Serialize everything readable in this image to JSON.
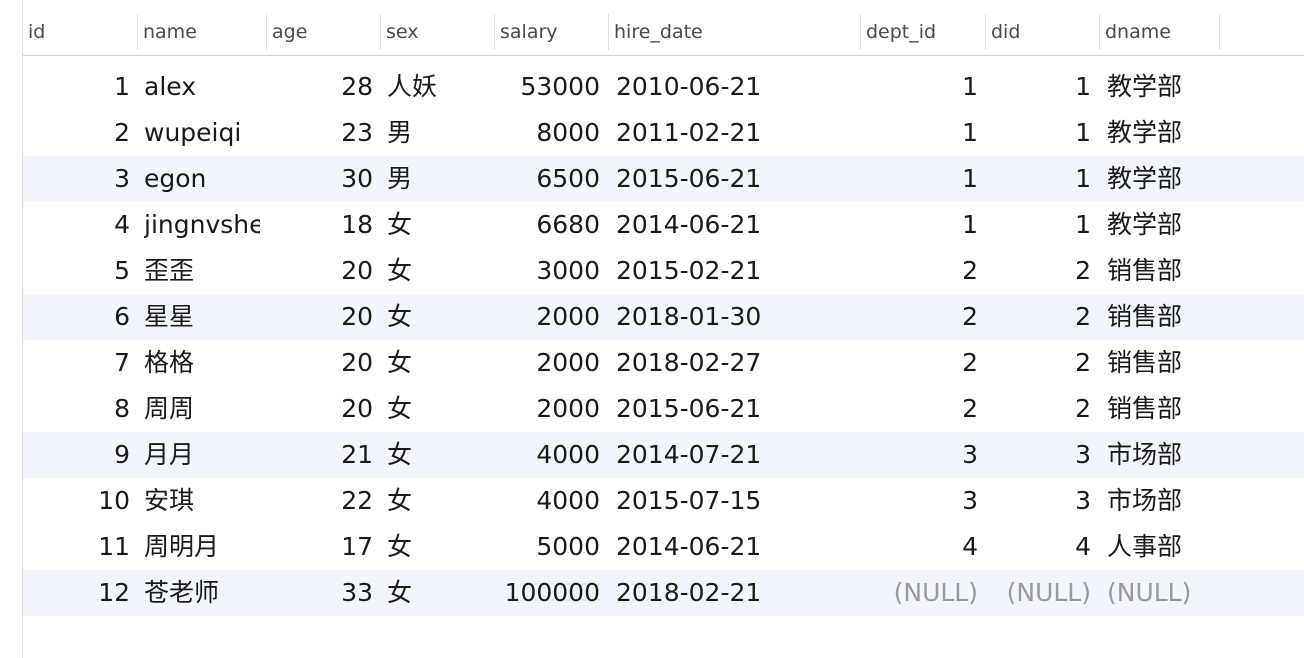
{
  "columns": [
    {
      "key": "id",
      "label": "id"
    },
    {
      "key": "name",
      "label": "name"
    },
    {
      "key": "age",
      "label": "age"
    },
    {
      "key": "sex",
      "label": "sex"
    },
    {
      "key": "salary",
      "label": "salary"
    },
    {
      "key": "hire_date",
      "label": "hire_date"
    },
    {
      "key": "dept_id",
      "label": "dept_id"
    },
    {
      "key": "did",
      "label": "did"
    },
    {
      "key": "dname",
      "label": "dname"
    }
  ],
  "rows": [
    {
      "id": "1",
      "name": "alex",
      "age": "28",
      "sex": "人妖",
      "salary": "53000",
      "hire_date": "2010-06-21",
      "dept_id": "1",
      "did": "1",
      "dname": "教学部"
    },
    {
      "id": "2",
      "name": "wupeiqi",
      "age": "23",
      "sex": "男",
      "salary": "8000",
      "hire_date": "2011-02-21",
      "dept_id": "1",
      "did": "1",
      "dname": "教学部"
    },
    {
      "id": "3",
      "name": "egon",
      "age": "30",
      "sex": "男",
      "salary": "6500",
      "hire_date": "2015-06-21",
      "dept_id": "1",
      "did": "1",
      "dname": "教学部"
    },
    {
      "id": "4",
      "name": "jingnvshen",
      "age": "18",
      "sex": "女",
      "salary": "6680",
      "hire_date": "2014-06-21",
      "dept_id": "1",
      "did": "1",
      "dname": "教学部"
    },
    {
      "id": "5",
      "name": "歪歪",
      "age": "20",
      "sex": "女",
      "salary": "3000",
      "hire_date": "2015-02-21",
      "dept_id": "2",
      "did": "2",
      "dname": "销售部"
    },
    {
      "id": "6",
      "name": "星星",
      "age": "20",
      "sex": "女",
      "salary": "2000",
      "hire_date": "2018-01-30",
      "dept_id": "2",
      "did": "2",
      "dname": "销售部"
    },
    {
      "id": "7",
      "name": "格格",
      "age": "20",
      "sex": "女",
      "salary": "2000",
      "hire_date": "2018-02-27",
      "dept_id": "2",
      "did": "2",
      "dname": "销售部"
    },
    {
      "id": "8",
      "name": "周周",
      "age": "20",
      "sex": "女",
      "salary": "2000",
      "hire_date": "2015-06-21",
      "dept_id": "2",
      "did": "2",
      "dname": "销售部"
    },
    {
      "id": "9",
      "name": "月月",
      "age": "21",
      "sex": "女",
      "salary": "4000",
      "hire_date": "2014-07-21",
      "dept_id": "3",
      "did": "3",
      "dname": "市场部"
    },
    {
      "id": "10",
      "name": "安琪",
      "age": "22",
      "sex": "女",
      "salary": "4000",
      "hire_date": "2015-07-15",
      "dept_id": "3",
      "did": "3",
      "dname": "市场部"
    },
    {
      "id": "11",
      "name": "周明月",
      "age": "17",
      "sex": "女",
      "salary": "5000",
      "hire_date": "2014-06-21",
      "dept_id": "4",
      "did": "4",
      "dname": "人事部"
    },
    {
      "id": "12",
      "name": "苍老师",
      "age": "33",
      "sex": "女",
      "salary": "100000",
      "hire_date": "2018-02-21",
      "dept_id": "(NULL)",
      "did": "(NULL)",
      "dname": "(NULL)"
    }
  ],
  "null_text": "(NULL)",
  "colors": {
    "alt_row": "#f2f5fb",
    "null_text": "#9a9a9a",
    "header_text": "#4a4a4a"
  }
}
